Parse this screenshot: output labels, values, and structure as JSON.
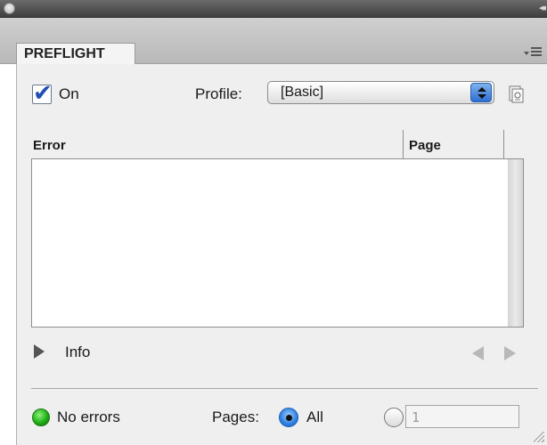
{
  "panel": {
    "tab_label": "PREFLIGHT",
    "collapse_glyph": "◂◂"
  },
  "preflight": {
    "on_checked": true,
    "on_label": "On",
    "profile_label": "Profile:",
    "profile_value": "[Basic]"
  },
  "table": {
    "columns": [
      "Error",
      "Page"
    ],
    "rows": []
  },
  "info": {
    "label": "Info",
    "expanded": false
  },
  "status": {
    "text": "No errors",
    "color": "#1fae16"
  },
  "pages": {
    "label": "Pages:",
    "all_label": "All",
    "all_selected": true,
    "range_value": "1"
  }
}
